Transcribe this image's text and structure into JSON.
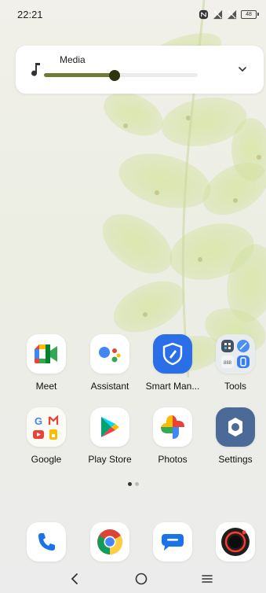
{
  "status_bar": {
    "time": "22:21",
    "battery_level": "48"
  },
  "volume_panel": {
    "label": "Media",
    "level_percent": 46
  },
  "apps_row1": [
    {
      "label": "Meet",
      "icon": "google-meet-icon"
    },
    {
      "label": "Assistant",
      "icon": "google-assistant-icon"
    },
    {
      "label": "Smart Man...",
      "icon": "smart-manager-shield-icon"
    },
    {
      "label": "Tools",
      "icon": "tools-folder-icon"
    }
  ],
  "apps_row2": [
    {
      "label": "Google",
      "icon": "google-folder-icon"
    },
    {
      "label": "Play Store",
      "icon": "play-store-icon"
    },
    {
      "label": "Photos",
      "icon": "google-photos-icon"
    },
    {
      "label": "Settings",
      "icon": "settings-gear-icon"
    }
  ],
  "page_indicator": {
    "pages": 2,
    "current": 1
  },
  "dock": [
    {
      "icon": "phone-icon"
    },
    {
      "icon": "chrome-icon"
    },
    {
      "icon": "messages-icon"
    },
    {
      "icon": "camera-icon"
    }
  ],
  "colors": {
    "accent": "#6f7c33",
    "thumb": "#2f3312"
  }
}
